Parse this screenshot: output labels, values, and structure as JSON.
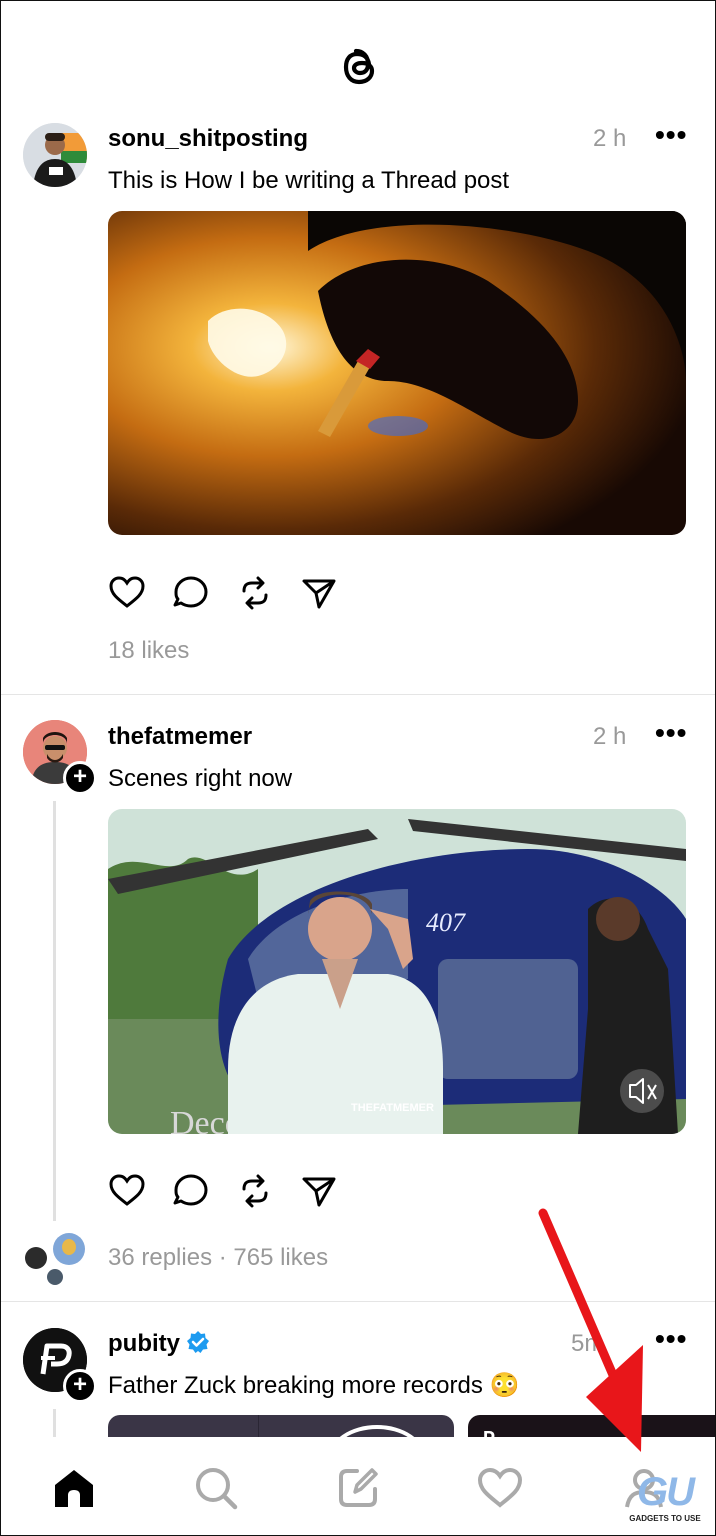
{
  "app": {
    "logo_icon": "threads-logo-icon"
  },
  "posts": [
    {
      "username": "sonu_shitposting",
      "time": "2 h",
      "caption": "This is How I be writing a Thread post",
      "meta": "18 likes"
    },
    {
      "username": "thefatmemer",
      "time": "2 h",
      "caption": "Scenes right now",
      "watermark": "THEFATMEMER",
      "heli_text": "Decca",
      "heli_tail": "407",
      "meta": "36 replies · 765 likes"
    },
    {
      "username": "pubity",
      "time": "5m",
      "caption": "Father Zuck breaking more records 😳",
      "verified": true
    }
  ],
  "nav": {
    "items": [
      "home-icon",
      "search-icon",
      "compose-icon",
      "activity-heart-icon",
      "profile-icon"
    ]
  },
  "watermark": {
    "logo": "GU",
    "tag": "GADGETS TO USE"
  },
  "colors": {
    "accent_red": "#e8161a",
    "muted_gray": "#999999",
    "verified_blue": "#1d9bf0"
  }
}
